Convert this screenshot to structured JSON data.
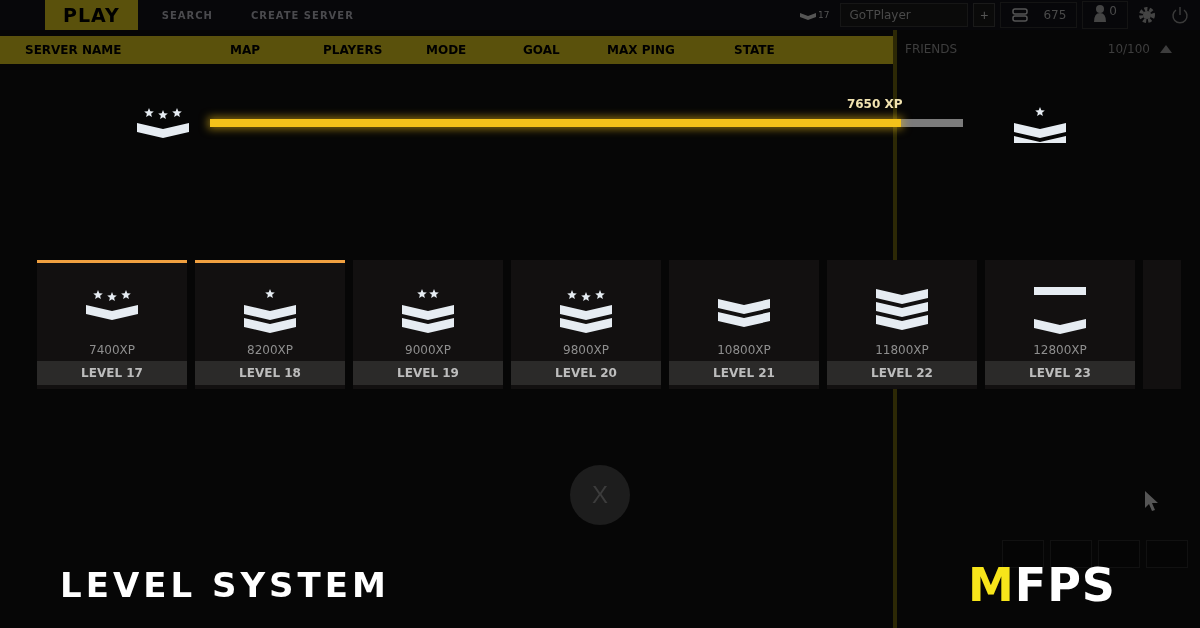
{
  "top_bar": {
    "tabs": [
      {
        "label": "PLAY",
        "selected": true
      },
      {
        "label": "SEARCH",
        "selected": false
      },
      {
        "label": "CREATE SERVER",
        "selected": false
      }
    ],
    "player_level": "17",
    "player_name": "GoTPlayer",
    "add_button": "+",
    "coins": "675",
    "friend_requests": "0"
  },
  "table": {
    "columns": [
      "SERVER NAME",
      "MAP",
      "PLAYERS",
      "MODE",
      "GOAL",
      "MAX PING",
      "STATE"
    ]
  },
  "friends": {
    "title": "FRIENDS",
    "count": "10/100",
    "expanded": true
  },
  "progress": {
    "level": 0.917,
    "reading": "7650 XP",
    "current_insignia": {
      "kind": "threestarsingle"
    },
    "next_insignia": {
      "kind": "onestardouble"
    }
  },
  "levels": [
    {
      "xp": "7400XP",
      "label": "LEVEL 17",
      "kind": "threestarsingle",
      "unlocked": true
    },
    {
      "xp": "8200XP",
      "label": "LEVEL 18",
      "kind": "onestardouble",
      "unlocked": true
    },
    {
      "xp": "9000XP",
      "label": "LEVEL 19",
      "kind": "twostardouble",
      "unlocked": false
    },
    {
      "xp": "9800XP",
      "label": "LEVEL 20",
      "kind": "threestardouble",
      "unlocked": false
    },
    {
      "xp": "10800XP",
      "label": "LEVEL 21",
      "kind": "double",
      "unlocked": false
    },
    {
      "xp": "11800XP",
      "label": "LEVEL 22",
      "kind": "triple",
      "unlocked": false
    },
    {
      "xp": "12800XP",
      "label": "LEVEL 23",
      "kind": "barred",
      "unlocked": false
    }
  ],
  "close_button": "X",
  "caption": "LEVEL SYSTEM",
  "logo": {
    "accent": "M",
    "rest": "FPS"
  }
}
